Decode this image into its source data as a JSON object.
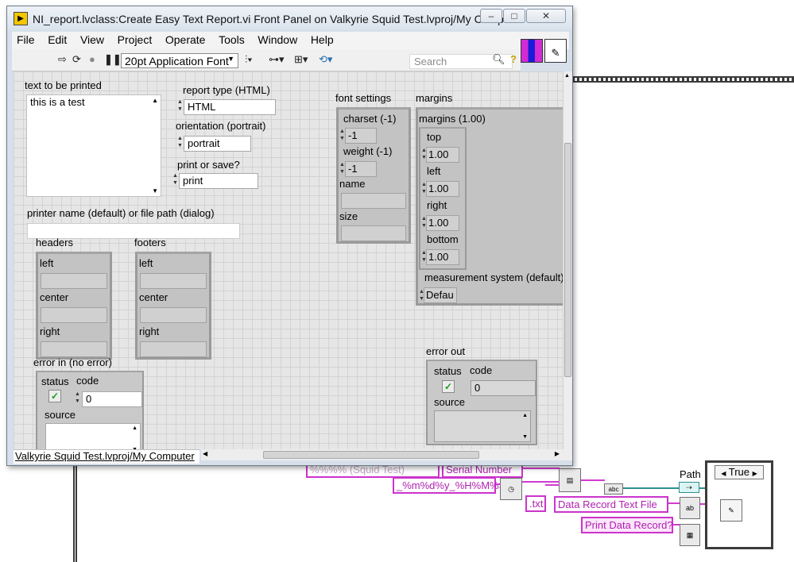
{
  "window": {
    "title": "NI_report.lvclass:Create Easy Text Report.vi Front Panel on Valkyrie Squid Test.lvproj/My Computer",
    "controls": {
      "minimize": "–",
      "maximize": "□",
      "close": "✕"
    }
  },
  "menu": [
    "File",
    "Edit",
    "View",
    "Project",
    "Operate",
    "Tools",
    "Window",
    "Help"
  ],
  "toolbar": {
    "font": "20pt Application Font",
    "search_placeholder": "Search",
    "help": "?"
  },
  "panel": {
    "text_to_print": {
      "label": "text to be printed",
      "value": "this is a test"
    },
    "report_type": {
      "label": "report type (HTML)",
      "value": "HTML"
    },
    "orientation": {
      "label": "orientation (portrait)",
      "value": "portrait"
    },
    "print_or_save": {
      "label": "print or save?",
      "value": "print"
    },
    "printer_name": {
      "label": "printer name (default) or file path (dialog)",
      "value": ""
    },
    "headers": {
      "label": "headers",
      "left": "left",
      "center": "center",
      "right": "right"
    },
    "footers": {
      "label": "footers",
      "left": "left",
      "center": "center",
      "right": "right"
    },
    "font_settings": {
      "label": "font settings",
      "charset": "charset (-1)",
      "charset_value": "-1",
      "weight": "weight (-1)",
      "weight_value": "-1",
      "name": "name",
      "size": "size"
    },
    "margins": {
      "label": "margins",
      "inner_label": "margins (1.00)",
      "top": "top",
      "top_value": "1.00",
      "left": "left",
      "left_value": "1.00",
      "right": "right",
      "right_value": "1.00",
      "bottom": "bottom",
      "bottom_value": "1.00",
      "measurement": "measurement system (default)",
      "measurement_value": "Defau"
    },
    "error_in": {
      "label": "error in (no error)",
      "status": "status",
      "code": "code",
      "code_value": "0",
      "source": "source"
    },
    "error_out": {
      "label": "error out",
      "status": "status",
      "code": "code",
      "code_value": "0",
      "source": "source"
    }
  },
  "statusbar": {
    "project": "Valkyrie Squid Test.lvproj/My Computer"
  },
  "diagram": {
    "serial_number": "Serial Number",
    "date_format": "_%m%d%y_%H%M%S",
    "partial_text": "%%%% (Squid Test)",
    "ext": ".txt",
    "data_record_file": "Data Record Text File",
    "print_record": "Print Data Record?",
    "path_label": "Path",
    "case_selector": "True"
  }
}
